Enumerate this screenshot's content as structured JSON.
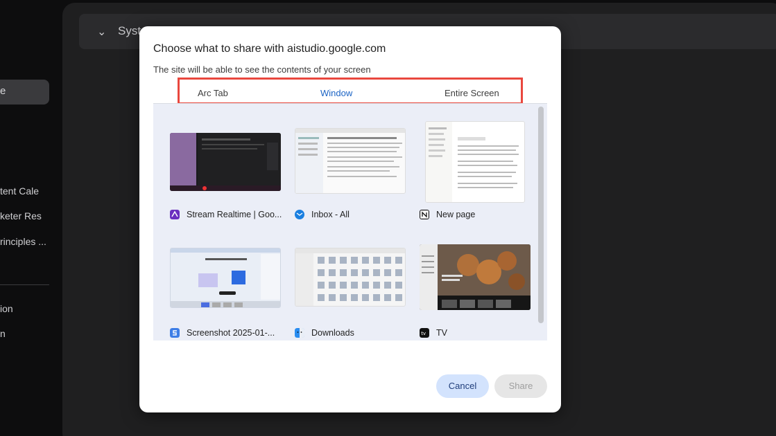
{
  "background": {
    "section_title": "Syst",
    "sidebar_active": "e",
    "sidebar_items": [
      "tent Cale",
      "keter Res",
      "rinciples ...",
      "ion",
      "n"
    ]
  },
  "dialog": {
    "title": "Choose what to share with aistudio.google.com",
    "subtitle": "The site will be able to see the contents of your screen",
    "tabs": [
      {
        "label": "Arc Tab",
        "active": false
      },
      {
        "label": "Window",
        "active": true
      },
      {
        "label": "Entire Screen",
        "active": false
      }
    ],
    "windows": [
      {
        "label": "Stream Realtime | Goo...",
        "icon": "ai-studio-icon",
        "icon_color": "#6b2fbf"
      },
      {
        "label": "Inbox - All",
        "icon": "mail-icon",
        "icon_color": "#1a7fe0"
      },
      {
        "label": "New page",
        "icon": "notion-icon",
        "icon_color": "#111111"
      },
      {
        "label": "Screenshot 2025-01-...",
        "icon": "screenshot-icon",
        "icon_color": "#3d7de6"
      },
      {
        "label": "Downloads",
        "icon": "finder-icon",
        "icon_color": "#2a8df0"
      },
      {
        "label": "TV",
        "icon": "apple-tv-icon",
        "icon_color": "#111111"
      }
    ],
    "cancel_label": "Cancel",
    "share_label": "Share"
  },
  "colors": {
    "accent": "#1a63c4",
    "highlight_box": "#e9473e",
    "cancel_bg": "#d3e3fd"
  }
}
